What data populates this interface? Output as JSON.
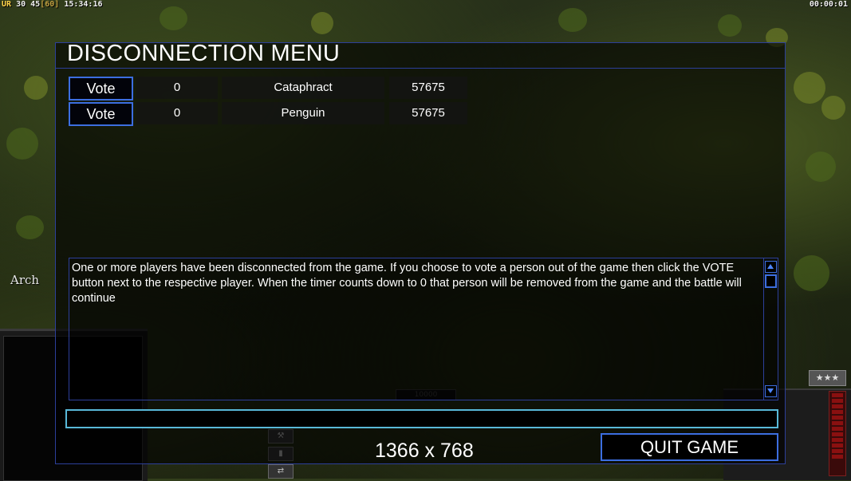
{
  "hud": {
    "ur_label": "UR",
    "ur_value": "30",
    "fps": "45",
    "fps_max": "[60]",
    "clock": "15:34:16",
    "timer": "00:00:01"
  },
  "side_label": "Arch",
  "background_hud": {
    "money": "10000",
    "rank": "★★★"
  },
  "dialog": {
    "title": "DISCONNECTION MENU",
    "players": [
      {
        "vote_label": "Vote",
        "votes": "0",
        "name": "Cataphract",
        "ping": "57675"
      },
      {
        "vote_label": "Vote",
        "votes": "0",
        "name": "Penguin",
        "ping": "57675"
      }
    ],
    "message": "One or more players have been disconnected from the game. If you choose to vote a person out of the game then click the VOTE button next to the respective player. When the timer counts down to 0 that person will be removed from the game and the battle will continue",
    "chat_value": "",
    "resolution": "1366 x 768",
    "quit_label": "QUIT GAME"
  },
  "colors": {
    "border_blue": "#2c3f9a",
    "button_blue": "#3c6ee0",
    "input_cyan": "#58b8d8"
  }
}
